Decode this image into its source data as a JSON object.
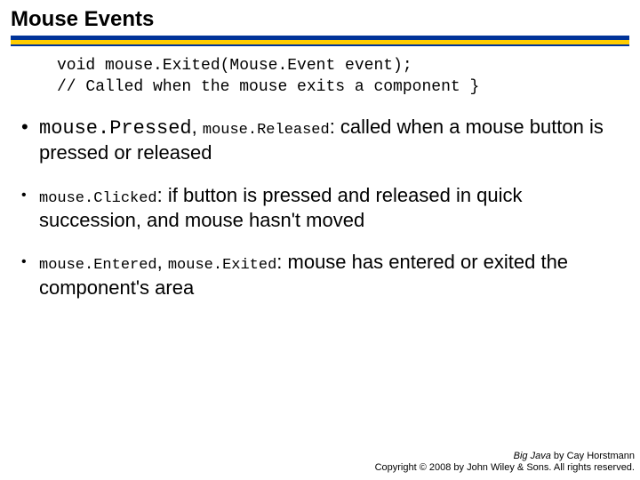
{
  "title": "Mouse Events",
  "code": {
    "line1": "void mouse.Exited(Mouse.Event event);",
    "line2": "// Called when the mouse exits a component }"
  },
  "bullets": {
    "b1": {
      "m1": "mouse.Pressed",
      "sep1": ", ",
      "m2": "mouse.Released",
      "rest": ": called when a mouse button is pressed or released"
    },
    "b2": {
      "m1": "mouse.Clicked",
      "rest": ": if button is pressed and released in quick succession, and mouse hasn't moved"
    },
    "b3": {
      "m1": "mouse.Entered",
      "sep1": ", ",
      "m2": "mouse.Exited",
      "rest": ": mouse has entered or exited the component's area"
    }
  },
  "footer": {
    "book": "Big Java",
    "byline": " by Cay Horstmann",
    "copyright": "Copyright © 2008 by John Wiley & Sons. All rights reserved."
  }
}
